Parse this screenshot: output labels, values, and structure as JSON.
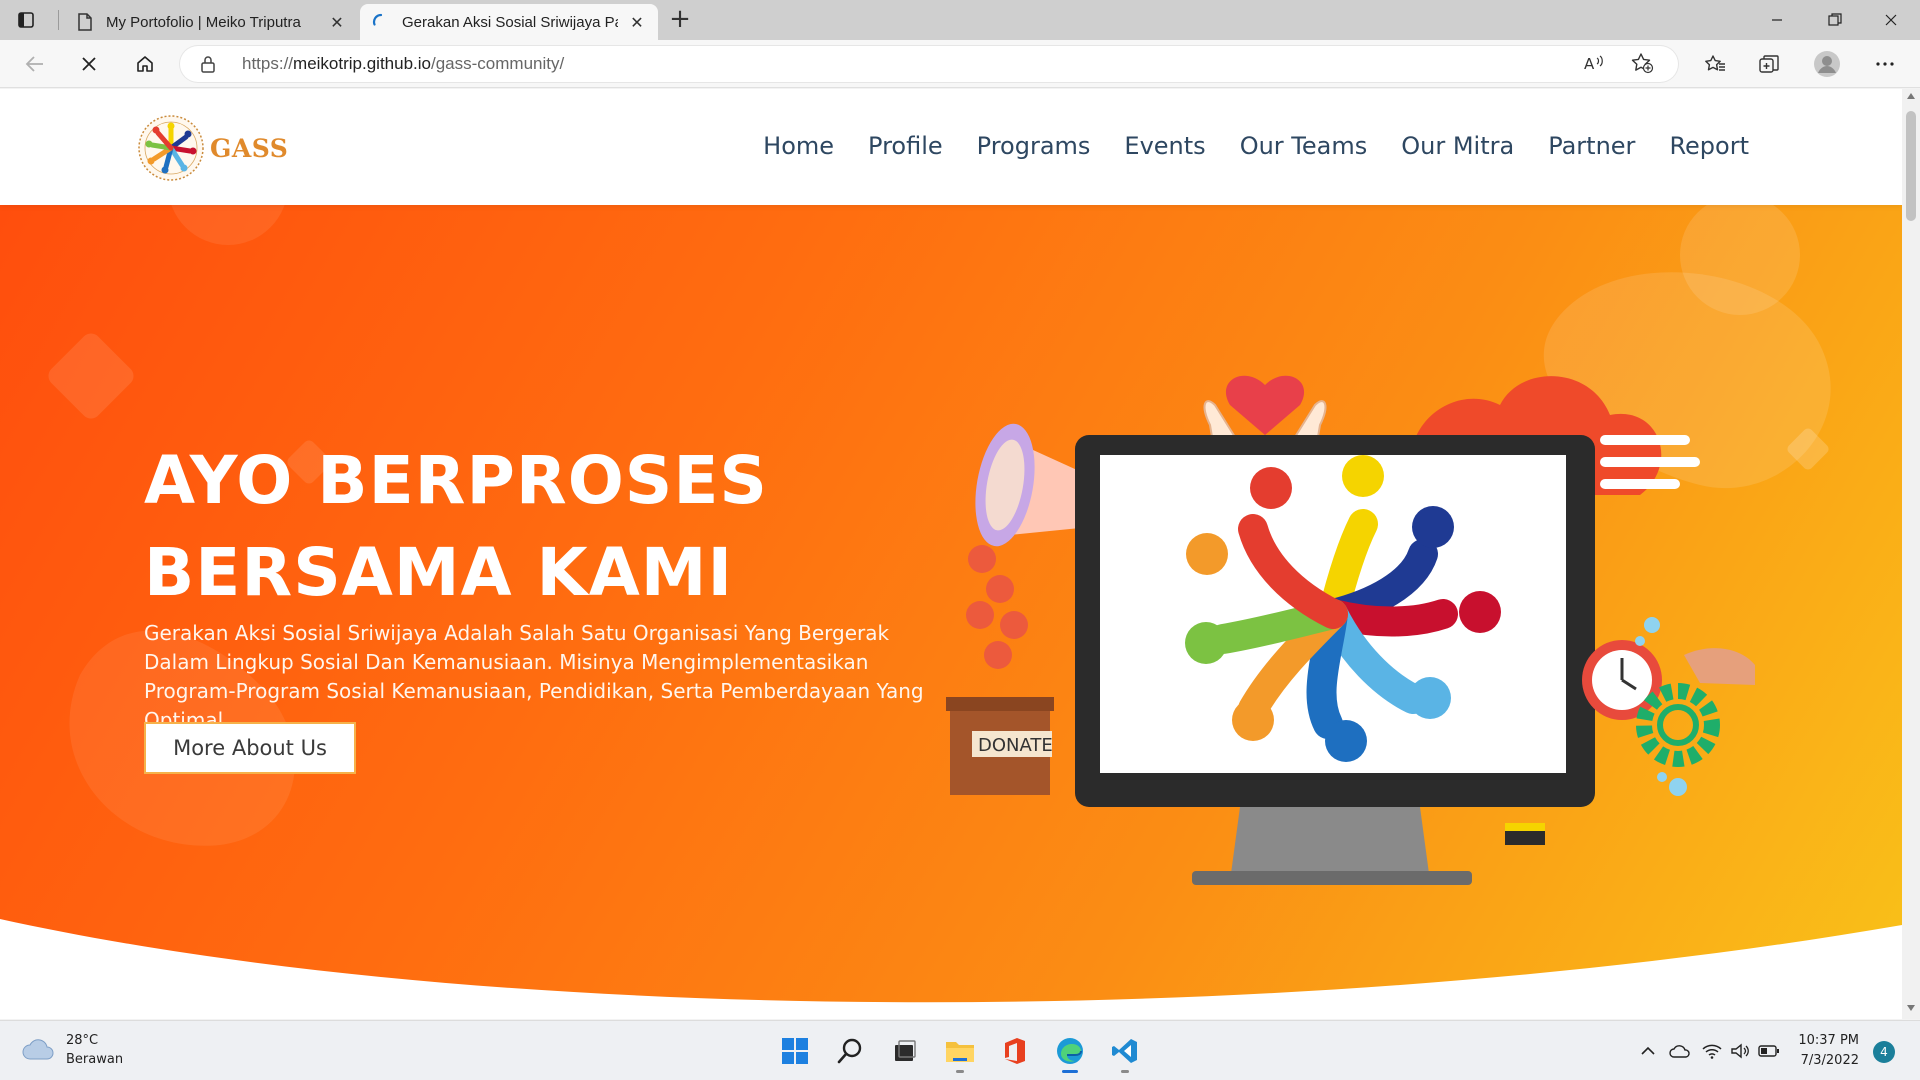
{
  "browser": {
    "tabs": [
      {
        "title": "My Portofolio | Meiko Triputra",
        "active": false
      },
      {
        "title": "Gerakan Aksi Sosial Sriwijaya Pag",
        "active": true
      }
    ],
    "new_tab_label": "+",
    "address": {
      "url_prefix": "https://",
      "url_host": "meikotrip.github.io",
      "url_path": "/gass-community/"
    },
    "loading": true,
    "icons": [
      "tab-actions-icon",
      "page-icon",
      "loading-spinner-icon",
      "close-icon",
      "minimize-icon",
      "maximize-icon",
      "back-icon",
      "stop-icon",
      "home-icon",
      "lock-icon",
      "read-aloud-icon",
      "add-favorite-icon",
      "favorites-icon",
      "collections-icon",
      "profile-avatar",
      "more-icon"
    ]
  },
  "site": {
    "logo_text": "GASS",
    "nav": [
      "Home",
      "Profile",
      "Programs",
      "Events",
      "Our Teams",
      "Our Mitra",
      "Partner",
      "Report"
    ],
    "hero": {
      "title_line1": "AYO BERPROSES",
      "title_line2": "BERSAMA KAMI",
      "description": "Gerakan Aksi Sosial Sriwijaya Adalah Salah Satu Organisasi Yang Bergerak Dalam Lingkup Sosial Dan Kemanusiaan. Misinya Mengimplementasikan Program-Program Sosial Kemanusiaan, Pendidikan, Serta Pemberdayaan Yang Optimal.",
      "button_label": "More About Us",
      "illustration_label": "DONATE"
    },
    "colors": {
      "gradient_start": "#ff4e0d",
      "gradient_end": "#f9c219",
      "nav_text": "#2e4761",
      "logo_text": "#e08a2c"
    }
  },
  "taskbar": {
    "weather_temp": "28°C",
    "weather_desc": "Berawan",
    "apps": [
      "start-icon",
      "search-icon",
      "task-view-icon",
      "file-explorer-icon",
      "office-icon",
      "edge-icon",
      "vscode-icon"
    ],
    "time": "10:37 PM",
    "date": "7/3/2022",
    "notification_count": "4"
  }
}
